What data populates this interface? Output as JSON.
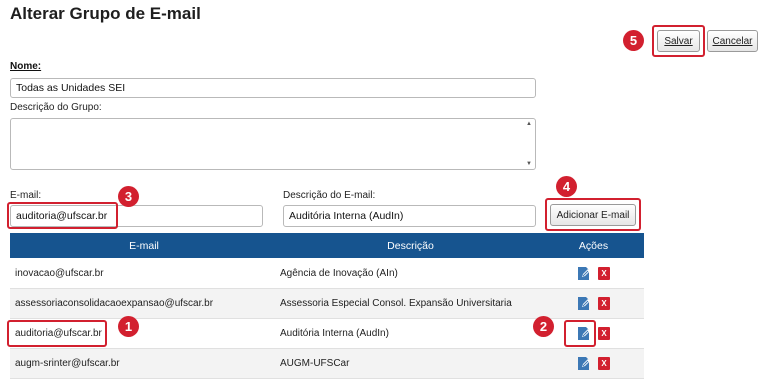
{
  "page_title": "Alterar Grupo de E-mail",
  "actions": {
    "save": "Salvar",
    "cancel": "Cancelar",
    "add_email": "Adicionar E-mail"
  },
  "form": {
    "name_label": "Nome:",
    "name_value": "Todas as Unidades SEI",
    "description_label": "Descrição do Grupo:",
    "description_value": "",
    "email_label": "E-mail:",
    "email_value": "auditoria@ufscar.br",
    "email_desc_label": "Descrição do E-mail:",
    "email_desc_value": "Auditória Interna (AudIn)"
  },
  "table": {
    "columns": [
      "E-mail",
      "Descrição",
      "Ações"
    ],
    "rows": [
      {
        "email": "inovacao@ufscar.br",
        "description": "Agência de Inovação (AIn)"
      },
      {
        "email": "assessoriaconsolidacaoexpansao@ufscar.br",
        "description": "Assessoria Especial Consol. Expansão Universitaria"
      },
      {
        "email": "auditoria@ufscar.br",
        "description": "Auditória Interna (AudIn)"
      },
      {
        "email": "augm-srinter@ufscar.br",
        "description": "AUGM-UFSCar"
      }
    ]
  },
  "callouts": [
    "1",
    "2",
    "3",
    "4",
    "5"
  ],
  "icons": {
    "edit": "edit-icon",
    "delete": "delete-icon"
  },
  "colors": {
    "header": "#16548f",
    "highlight": "#d2202f"
  }
}
